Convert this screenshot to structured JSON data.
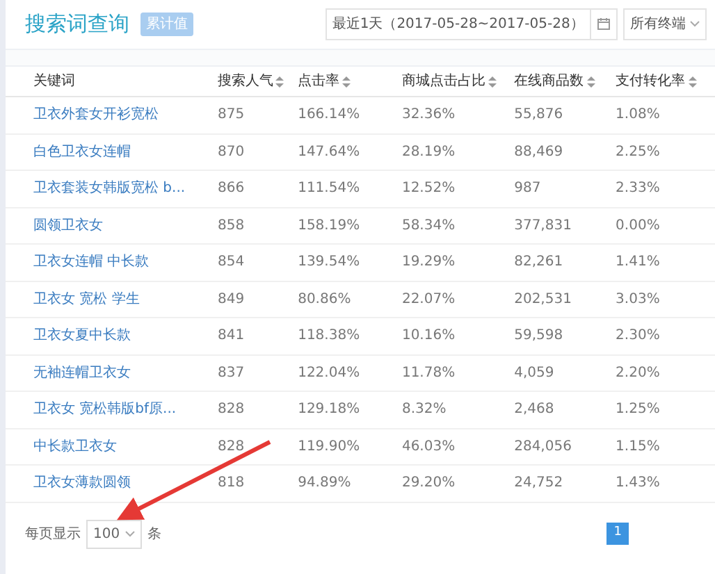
{
  "header": {
    "title": "搜索词查询",
    "badge": "累计值",
    "date_range": "最近1天（2017-05-28~2017-05-28）",
    "terminal": "所有终端"
  },
  "table": {
    "columns": [
      "关键词",
      "搜索人气",
      "点击率",
      "商城点击占比",
      "在线商品数",
      "支付转化率"
    ],
    "rows": [
      [
        "卫衣外套女开衫宽松",
        "875",
        "166.14%",
        "32.36%",
        "55,876",
        "1.08%"
      ],
      [
        "白色卫衣女连帽",
        "870",
        "147.64%",
        "28.19%",
        "88,469",
        "2.25%"
      ],
      [
        "卫衣套装女韩版宽松 b...",
        "866",
        "111.54%",
        "12.52%",
        "987",
        "2.33%"
      ],
      [
        "圆领卫衣女",
        "858",
        "158.19%",
        "58.34%",
        "377,831",
        "0.00%"
      ],
      [
        "卫衣女连帽 中长款",
        "854",
        "139.54%",
        "19.29%",
        "82,261",
        "1.41%"
      ],
      [
        "卫衣女 宽松 学生",
        "849",
        "80.86%",
        "22.07%",
        "202,531",
        "3.03%"
      ],
      [
        "卫衣女夏中长款",
        "841",
        "118.38%",
        "10.16%",
        "59,598",
        "2.30%"
      ],
      [
        "无袖连帽卫衣女",
        "837",
        "122.04%",
        "11.78%",
        "4,059",
        "2.20%"
      ],
      [
        "卫衣女 宽松韩版bf原...",
        "828",
        "129.18%",
        "8.32%",
        "2,468",
        "1.25%"
      ],
      [
        "中长款卫衣女",
        "828",
        "119.90%",
        "46.03%",
        "284,056",
        "1.15%"
      ],
      [
        "卫衣女薄款圆领",
        "818",
        "94.89%",
        "29.20%",
        "24,752",
        "1.43%"
      ]
    ]
  },
  "footer": {
    "page_size_label": "每页显示",
    "page_size": "100",
    "page_size_unit": "条",
    "pages": [
      {
        "label": "1",
        "selected": true
      }
    ]
  }
}
